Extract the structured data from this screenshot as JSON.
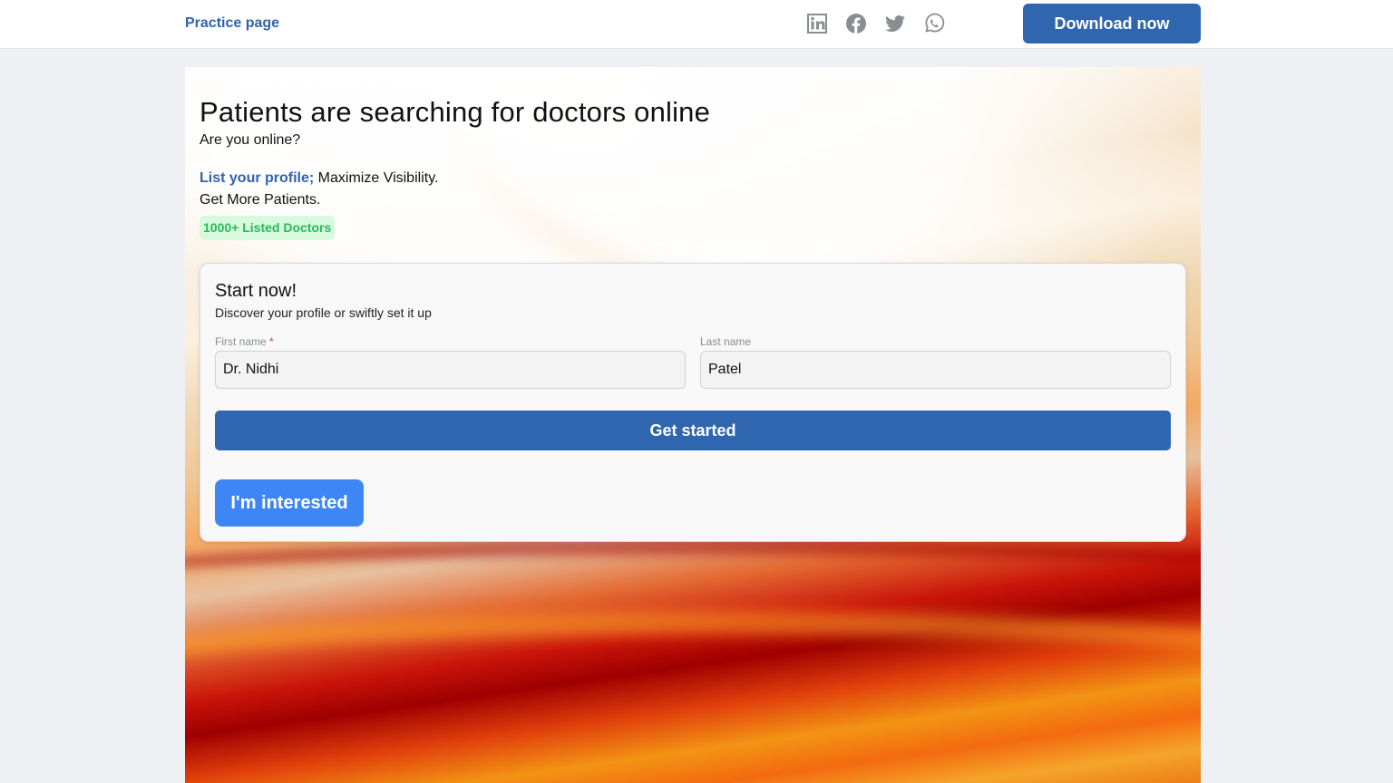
{
  "header": {
    "brand": "Practice page",
    "socials": [
      {
        "name": "linkedin-icon"
      },
      {
        "name": "facebook-icon"
      },
      {
        "name": "twitter-icon"
      },
      {
        "name": "whatsapp-icon"
      }
    ],
    "download_label": "Download now"
  },
  "hero": {
    "headline": "Patients are searching for doctors online",
    "subline": "Are you online?",
    "pitch_highlight": "List your profile;",
    "pitch_rest": " Maximize Visibility.",
    "pitch_line2": "Get More Patients.",
    "badge": "1000+ Listed Doctors"
  },
  "form": {
    "title": "Start now!",
    "subtitle": "Discover your profile or swiftly set it up",
    "first_name_label": "First name",
    "required_mark": "*",
    "first_name_value": "Dr. Nidhi",
    "last_name_label": "Last name",
    "last_name_value": "Patel",
    "submit_label": "Get started",
    "interested_label": "I'm interested"
  },
  "colors": {
    "accent": "#3066af",
    "link": "#2f64ad",
    "badge_bg": "#d7f9de",
    "badge_text": "#2bb957",
    "interested_bg": "#3e86f5"
  }
}
